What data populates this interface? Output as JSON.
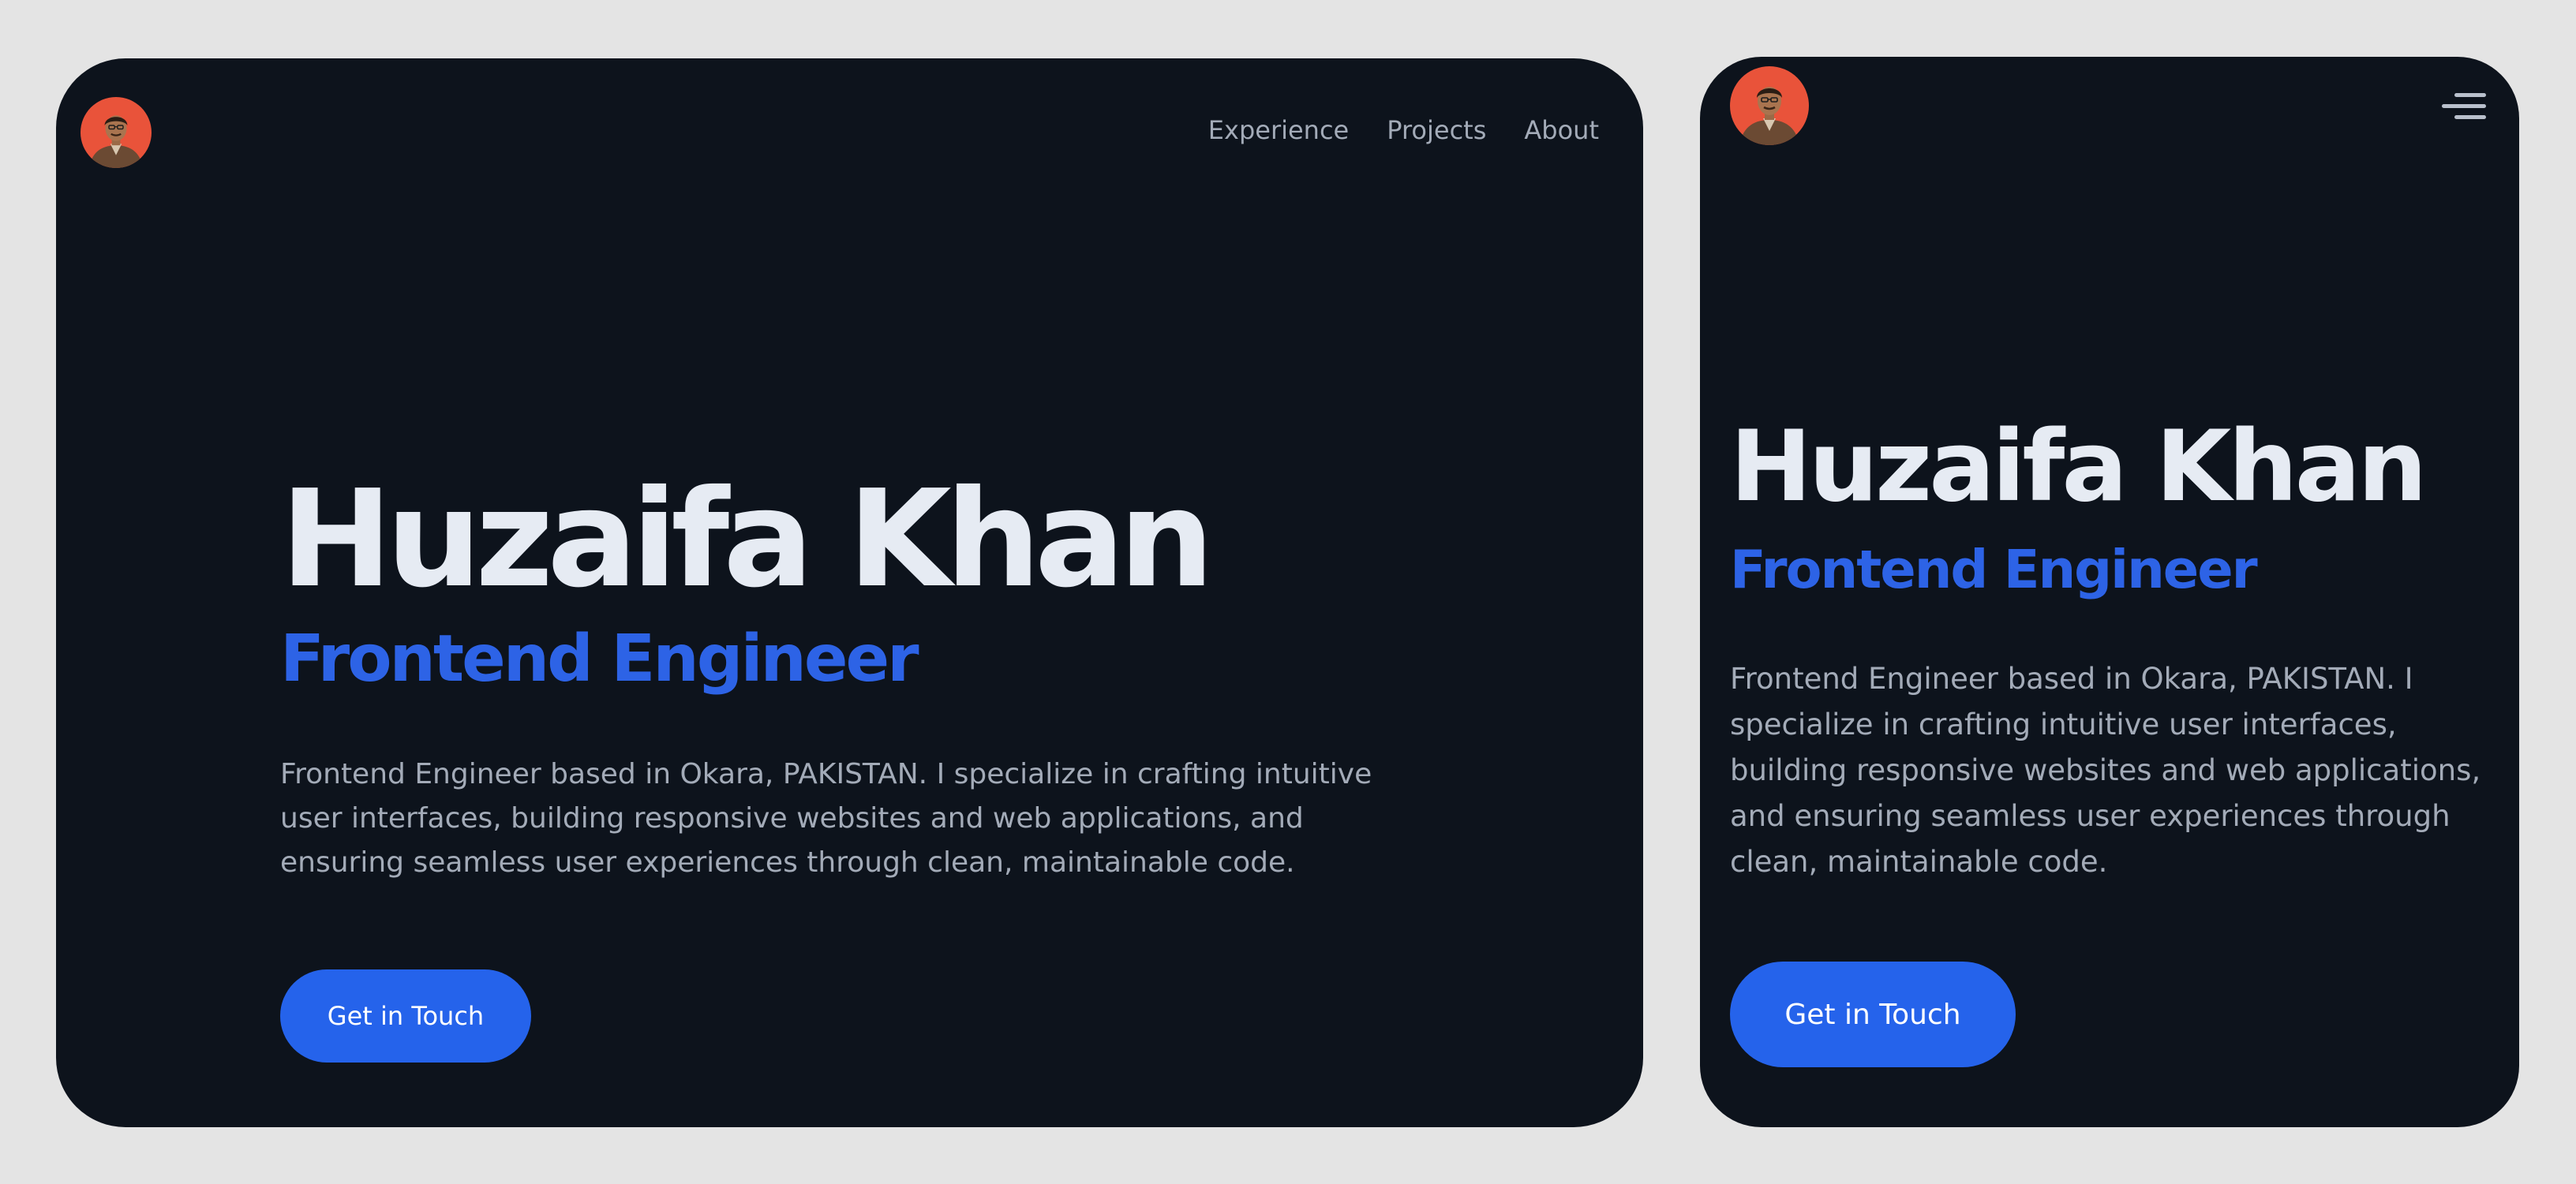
{
  "site": {
    "owner_name": "Huzaifa Khan",
    "role": "Frontend Engineer",
    "bio": "Frontend Engineer based in Okara, PAKISTAN. I specialize in crafting intuitive user interfaces, building responsive websites and web applications, and ensuring seamless user experiences through clean, maintainable code.",
    "cta_label": "Get in Touch"
  },
  "nav": {
    "items": [
      {
        "label": "Experience"
      },
      {
        "label": "Projects"
      },
      {
        "label": "About"
      }
    ]
  },
  "icons": {
    "avatar": "profile-photo-avatar",
    "menu": "hamburger-menu-icon"
  },
  "colors": {
    "page_background": "#e4e4e4",
    "card_background": "#0d131c",
    "heading": "#e6ebf3",
    "accent": "#2d63e6",
    "body_text": "#a3abb8",
    "button": "#2563eb",
    "button_text": "#ffffff",
    "avatar_ring": "#e9533a"
  }
}
